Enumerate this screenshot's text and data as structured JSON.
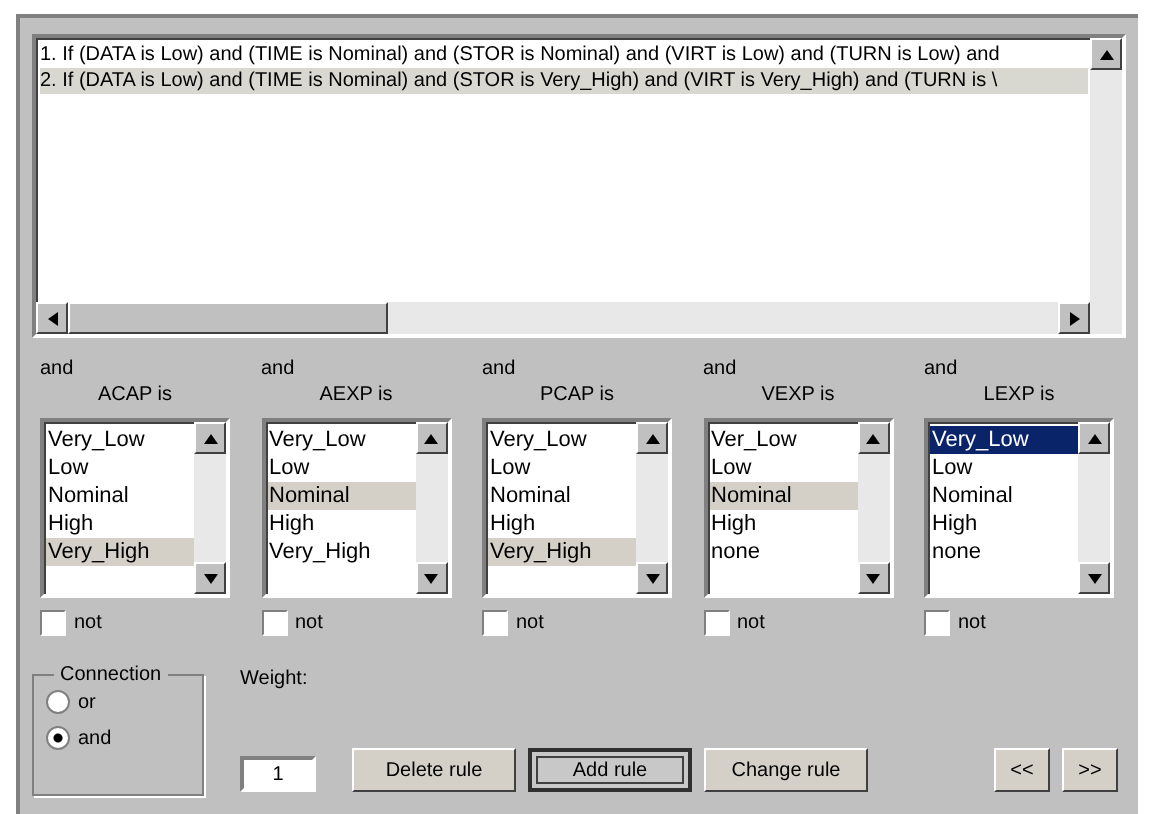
{
  "rules": [
    {
      "text": "1. If (DATA is Low) and (TIME is Nominal) and (STOR is Nominal) and (VIRT is Low) and (TURN is Low) and",
      "selected": false
    },
    {
      "text": "2. If (DATA is Low) and (TIME is Nominal) and (STOR is Very_High) and (VIRT is Very_High) and (TURN is \\",
      "selected": true
    }
  ],
  "columns": [
    {
      "prefix": "and",
      "label": "ACAP is",
      "focused": false,
      "not": false,
      "not_label": "not",
      "items": [
        {
          "text": "Very_Low",
          "selected": false
        },
        {
          "text": "Low",
          "selected": false
        },
        {
          "text": "Nominal",
          "selected": false
        },
        {
          "text": "High",
          "selected": false
        },
        {
          "text": "Very_High",
          "selected": true
        }
      ]
    },
    {
      "prefix": "and",
      "label": "AEXP is",
      "focused": false,
      "not": false,
      "not_label": "not",
      "items": [
        {
          "text": "Very_Low",
          "selected": false
        },
        {
          "text": "Low",
          "selected": false
        },
        {
          "text": "Nominal",
          "selected": true
        },
        {
          "text": "High",
          "selected": false
        },
        {
          "text": "Very_High",
          "selected": false
        }
      ]
    },
    {
      "prefix": "and",
      "label": "PCAP is",
      "focused": false,
      "not": false,
      "not_label": "not",
      "items": [
        {
          "text": "Very_Low",
          "selected": false
        },
        {
          "text": "Low",
          "selected": false
        },
        {
          "text": "Nominal",
          "selected": false
        },
        {
          "text": "High",
          "selected": false
        },
        {
          "text": "Very_High",
          "selected": true
        }
      ]
    },
    {
      "prefix": "and",
      "label": "VEXP is",
      "focused": false,
      "not": false,
      "not_label": "not",
      "items": [
        {
          "text": "Ver_Low",
          "selected": false
        },
        {
          "text": "Low",
          "selected": false
        },
        {
          "text": "Nominal",
          "selected": true
        },
        {
          "text": "High",
          "selected": false
        },
        {
          "text": "none",
          "selected": false
        }
      ]
    },
    {
      "prefix": "and",
      "label": "LEXP is",
      "focused": true,
      "not": false,
      "not_label": "not",
      "items": [
        {
          "text": "Very_Low",
          "selected": true
        },
        {
          "text": "Low",
          "selected": false
        },
        {
          "text": "Nominal",
          "selected": false
        },
        {
          "text": "High",
          "selected": false
        },
        {
          "text": "none",
          "selected": false
        }
      ]
    }
  ],
  "connection": {
    "title": "Connection",
    "options": [
      {
        "label": "or",
        "selected": false
      },
      {
        "label": "and",
        "selected": true
      }
    ]
  },
  "weight": {
    "label": "Weight:",
    "value": "1"
  },
  "buttons": [
    {
      "label": "Delete rule",
      "focused": false
    },
    {
      "label": "Add rule",
      "focused": true
    },
    {
      "label": "Change rule",
      "focused": false
    }
  ],
  "nav": [
    {
      "label": "<<"
    },
    {
      "label": ">>"
    }
  ]
}
